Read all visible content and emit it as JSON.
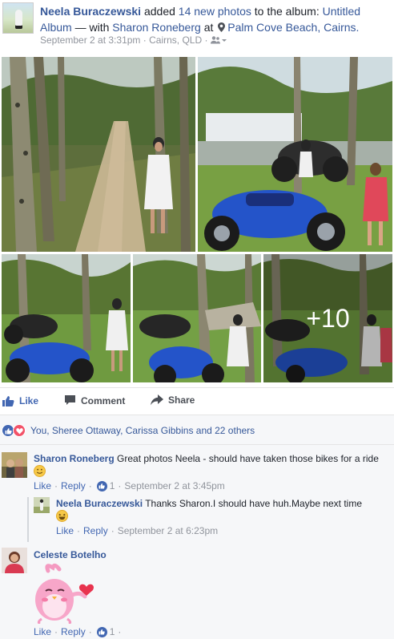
{
  "post": {
    "author": "Neela Buraczewski",
    "action_text": "added",
    "photo_count_text": "14 new photos",
    "to_text": "to the album:",
    "album_name": "Untitled Album",
    "with_text": "— with",
    "tagged_person": "Sharon Roneberg",
    "at_text": "at",
    "location": "Palm Cove Beach, Cairns.",
    "date": "September 2 at 3:31pm",
    "place": "Cairns, QLD",
    "separator": "·",
    "more_photos": "+10"
  },
  "actions": {
    "like_label": "Like",
    "comment_label": "Comment",
    "share_label": "Share"
  },
  "reactions": {
    "summary": "You, Sheree Ottaway, Carissa Gibbins and 22 others"
  },
  "comments": [
    {
      "author": "Sharon Roneberg",
      "text": "Great photos Neela - should have taken those bikes for a ride",
      "like_label": "Like",
      "reply_label": "Reply",
      "like_count": "1",
      "time": "September 2 at 3:45pm",
      "replies": [
        {
          "author": "Neela Buraczewski",
          "text": "Thanks Sharon.I should have huh.Maybe next time",
          "like_label": "Like",
          "reply_label": "Reply",
          "time": "September 2 at 6:23pm"
        }
      ]
    },
    {
      "author": "Celeste Botelho",
      "text": "",
      "like_label": "Like",
      "reply_label": "Reply",
      "like_count": "1"
    }
  ],
  "colors": {
    "link_blue": "#365899",
    "action_blue": "#4267b2",
    "meta_gray": "#90949c",
    "love_red": "#f25268",
    "comment_bg": "#f6f7f9"
  },
  "icons": [
    "location-pin-icon",
    "audience-friends-icon",
    "thumbs-up-icon",
    "comment-bubble-icon",
    "share-arrow-icon",
    "like-reaction-icon",
    "love-reaction-icon",
    "smile-emoji-icon",
    "grin-emoji-icon",
    "bird-sticker"
  ]
}
